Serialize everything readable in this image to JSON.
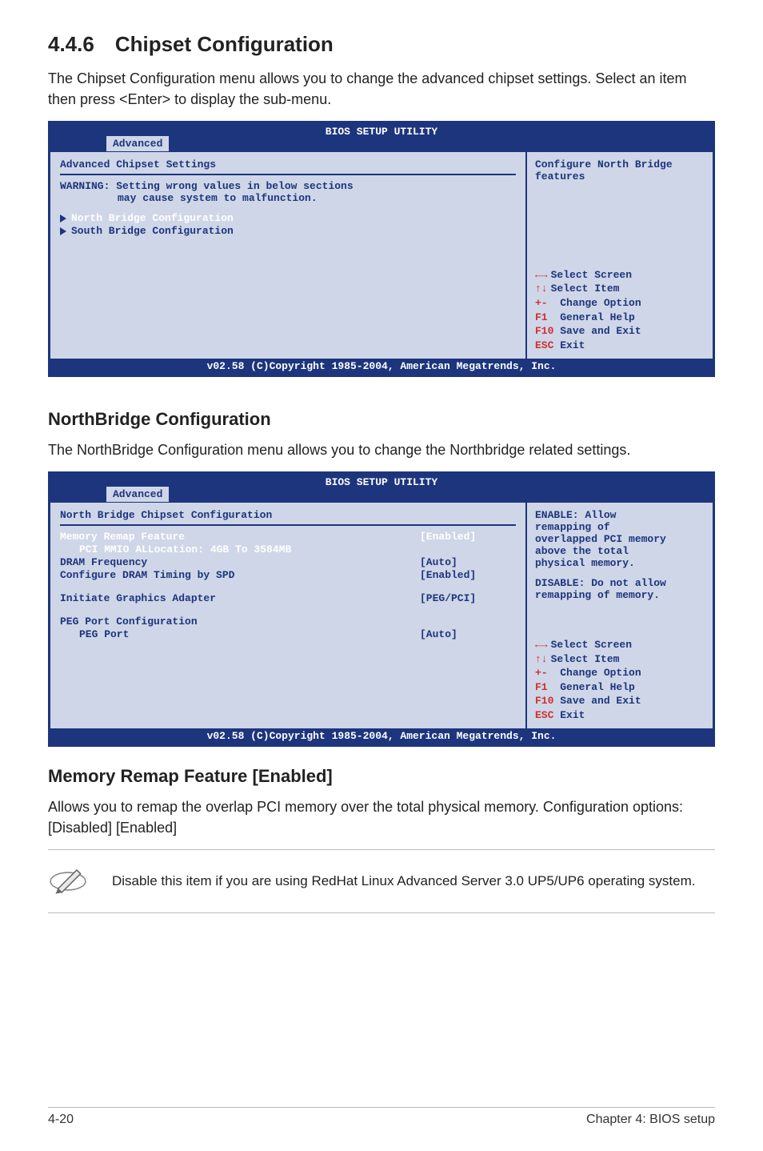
{
  "section_heading": "4.4.6 Chipset Configuration",
  "section_intro": "The Chipset Configuration menu allows you to change the advanced chipset settings. Select an item then press <Enter> to display the sub-menu.",
  "bios1": {
    "title": "BIOS SETUP UTILITY",
    "tab": "Advanced",
    "subtitle": "Advanced Chipset Settings",
    "warning_l1": "WARNING: Setting wrong values in below sections",
    "warning_l2": "may cause system to malfunction.",
    "item1": "North Bridge Configuration",
    "item2": "South Bridge Configuration",
    "help_l1": "Configure North Bridge",
    "help_l2": "features",
    "nav": {
      "select_screen": "Select Screen",
      "select_item": "Select Item",
      "change_option_key": "+-",
      "change_option": "Change Option",
      "general_help_key": "F1",
      "general_help": "General Help",
      "save_exit_key": "F10",
      "save_exit": "Save and Exit",
      "esc_key": "ESC",
      "esc": "Exit"
    },
    "footer": "v02.58 (C)Copyright 1985-2004, American Megatrends, Inc."
  },
  "nb_heading": "NorthBridge Configuration",
  "nb_intro": "The NorthBridge Configuration menu allows you to change the Northbridge related settings.",
  "bios2": {
    "title": "BIOS SETUP UTILITY",
    "tab": "Advanced",
    "subtitle": "North Bridge Chipset Configuration",
    "rows": {
      "mem_remap_label": "Memory Remap Feature",
      "mem_remap_value": "[Enabled]",
      "pci_alloc_label": "PCI MMIO ALLocation: 4GB To 3584MB",
      "dram_freq_label": "DRAM Frequency",
      "dram_freq_value": "[Auto]",
      "cfg_dram_label": "Configure DRAM Timing by SPD",
      "cfg_dram_value": "[Enabled]",
      "iga_label": "Initiate Graphics Adapter",
      "iga_value": "[PEG/PCI]",
      "peg_conf_label": "PEG Port Configuration",
      "peg_port_label": "PEG Port",
      "peg_port_value": "[Auto]"
    },
    "help": {
      "l1": "ENABLE: Allow",
      "l2": "remapping of",
      "l3": "overlapped PCI memory",
      "l4": "above the total",
      "l5": "physical memory.",
      "l6": "DISABLE: Do not allow",
      "l7": "remapping of memory."
    },
    "nav": {
      "select_screen": "Select Screen",
      "select_item": "Select Item",
      "change_option_key": "+-",
      "change_option": "Change Option",
      "general_help_key": "F1",
      "general_help": "General Help",
      "save_exit_key": "F10",
      "save_exit": "Save and Exit",
      "esc_key": "ESC",
      "esc": "Exit"
    },
    "footer": "v02.58 (C)Copyright 1985-2004, American Megatrends, Inc."
  },
  "mem_remap_heading": "Memory Remap Feature [Enabled]",
  "mem_remap_body": "Allows you to remap the overlap PCI memory over the total physical memory. Configuration options: [Disabled] [Enabled]",
  "note_text": "Disable this item if you are using RedHat Linux Advanced Server 3.0 UP5/UP6 operating system.",
  "page_footer_left": "4-20",
  "page_footer_right": "Chapter 4: BIOS setup"
}
